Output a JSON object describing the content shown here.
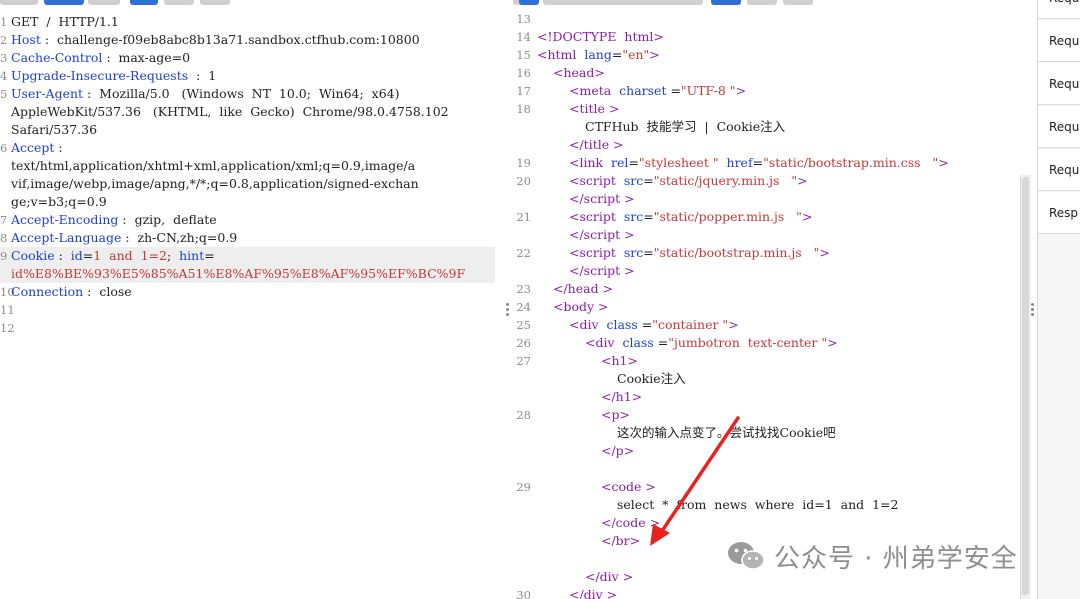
{
  "request": {
    "lines": [
      {
        "n": "1",
        "parts": [
          [
            "plain",
            "GET  /  HTTP/1.1"
          ]
        ]
      },
      {
        "n": "2",
        "parts": [
          [
            "hname",
            "Host"
          ],
          [
            "plain",
            " :  challenge-f09eb8abc8b13a71.sandbox.ctfhub.com:10800"
          ]
        ]
      },
      {
        "n": "3",
        "parts": [
          [
            "hname",
            "Cache-Control"
          ],
          [
            "plain",
            " :  max-age=0"
          ]
        ]
      },
      {
        "n": "4",
        "parts": [
          [
            "hname",
            "Upgrade-Insecure-Requests"
          ],
          [
            "plain",
            "  :  1"
          ]
        ]
      },
      {
        "n": "5",
        "parts": [
          [
            "hname",
            "User-Agent"
          ],
          [
            "plain",
            " :  Mozilla/5.0   (Windows  NT  10.0;  Win64;  x64)"
          ]
        ]
      },
      {
        "n": "",
        "parts": [
          [
            "plain",
            "AppleWebKit/537.36   (KHTML,  like  Gecko)  Chrome/98.0.4758.102"
          ]
        ]
      },
      {
        "n": "",
        "parts": [
          [
            "plain",
            "Safari/537.36"
          ]
        ]
      },
      {
        "n": "6",
        "parts": [
          [
            "hname",
            "Accept"
          ],
          [
            "plain",
            " :"
          ]
        ]
      },
      {
        "n": "",
        "parts": [
          [
            "plain",
            "text/html,application/xhtml+xml,application/xml;q=0.9,image/a"
          ]
        ]
      },
      {
        "n": "",
        "parts": [
          [
            "plain",
            "vif,image/webp,image/apng,*/*;q=0.8,application/signed-exchan"
          ]
        ]
      },
      {
        "n": "",
        "parts": [
          [
            "plain",
            "ge;v=b3;q=0.9"
          ]
        ]
      },
      {
        "n": "7",
        "parts": [
          [
            "hname",
            "Accept-Encoding"
          ],
          [
            "plain",
            " :  gzip,  deflate"
          ]
        ]
      },
      {
        "n": "8",
        "parts": [
          [
            "hname",
            "Accept-Language"
          ],
          [
            "plain",
            " :  zh-CN,zh;q=0.9"
          ]
        ]
      },
      {
        "n": "9",
        "hl": true,
        "parts": [
          [
            "hname",
            "Cookie"
          ],
          [
            "plain",
            " :  "
          ],
          [
            "hname",
            "id"
          ],
          [
            "plain",
            "="
          ],
          [
            "cred",
            "1  and  1=2"
          ],
          [
            "plain",
            ";  "
          ],
          [
            "hname",
            "hint"
          ],
          [
            "plain",
            "="
          ]
        ]
      },
      {
        "n": "",
        "hl": true,
        "parts": [
          [
            "cred",
            "id%E8%BE%93%E5%85%A51%E8%AF%95%E8%AF%95%EF%BC%9F"
          ]
        ]
      },
      {
        "n": "10",
        "parts": [
          [
            "hname",
            "Connection"
          ],
          [
            "plain",
            " :  close"
          ]
        ]
      },
      {
        "n": "11",
        "parts": []
      },
      {
        "n": "12",
        "parts": []
      }
    ]
  },
  "response": {
    "lines": [
      {
        "n": "13",
        "indent": 0,
        "parts": []
      },
      {
        "n": "14",
        "indent": 0,
        "parts": [
          [
            "tag",
            "<!DOCTYPE  html>"
          ]
        ]
      },
      {
        "n": "15",
        "indent": 0,
        "parts": [
          [
            "tag",
            "<html"
          ],
          [
            "attr",
            "  lang"
          ],
          [
            "plain",
            "="
          ],
          [
            "aval",
            "\"en\""
          ],
          [
            "tag",
            ">"
          ]
        ]
      },
      {
        "n": "16",
        "indent": 1,
        "parts": [
          [
            "tag",
            "<head"
          ],
          [
            "tag",
            ">"
          ]
        ]
      },
      {
        "n": "17",
        "indent": 2,
        "parts": [
          [
            "tag",
            "<meta"
          ],
          [
            "attr",
            "  charset"
          ],
          [
            "plain",
            " ="
          ],
          [
            "aval",
            "\"UTF-8 \""
          ],
          [
            "tag",
            ">"
          ]
        ]
      },
      {
        "n": "18",
        "indent": 2,
        "parts": [
          [
            "tag",
            "<title"
          ],
          [
            "tag",
            " >"
          ]
        ]
      },
      {
        "n": "",
        "indent": 3,
        "parts": [
          [
            "plain",
            "CTFHub  技能学习  |  Cookie注入"
          ]
        ]
      },
      {
        "n": "",
        "indent": 2,
        "parts": [
          [
            "tag",
            "</title"
          ],
          [
            "tag",
            " >"
          ]
        ]
      },
      {
        "n": "19",
        "indent": 2,
        "parts": [
          [
            "tag",
            "<link"
          ],
          [
            "attr",
            "  rel"
          ],
          [
            "plain",
            "="
          ],
          [
            "aval",
            "\"stylesheet \""
          ],
          [
            "attr",
            "  href"
          ],
          [
            "plain",
            "="
          ],
          [
            "aval",
            "\"static/bootstrap.min.css   \""
          ],
          [
            "tag",
            ">"
          ]
        ]
      },
      {
        "n": "20",
        "indent": 2,
        "parts": [
          [
            "tag",
            "<script"
          ],
          [
            "attr",
            "  src"
          ],
          [
            "plain",
            "="
          ],
          [
            "aval",
            "\"static/jquery.min.js   \""
          ],
          [
            "tag",
            ">"
          ]
        ]
      },
      {
        "n": "",
        "indent": 2,
        "parts": [
          [
            "tag",
            "</script"
          ],
          [
            "tag",
            " >"
          ]
        ]
      },
      {
        "n": "21",
        "indent": 2,
        "parts": [
          [
            "tag",
            "<script"
          ],
          [
            "attr",
            "  src"
          ],
          [
            "plain",
            "="
          ],
          [
            "aval",
            "\"static/popper.min.js   \""
          ],
          [
            "tag",
            ">"
          ]
        ]
      },
      {
        "n": "",
        "indent": 2,
        "parts": [
          [
            "tag",
            "</script"
          ],
          [
            "tag",
            " >"
          ]
        ]
      },
      {
        "n": "22",
        "indent": 2,
        "parts": [
          [
            "tag",
            "<script"
          ],
          [
            "attr",
            "  src"
          ],
          [
            "plain",
            "="
          ],
          [
            "aval",
            "\"static/bootstrap.min.js   \""
          ],
          [
            "tag",
            ">"
          ]
        ]
      },
      {
        "n": "",
        "indent": 2,
        "parts": [
          [
            "tag",
            "</script"
          ],
          [
            "tag",
            " >"
          ]
        ]
      },
      {
        "n": "23",
        "indent": 1,
        "parts": [
          [
            "tag",
            "</head"
          ],
          [
            "tag",
            " >"
          ]
        ]
      },
      {
        "n": "24",
        "indent": 1,
        "parts": [
          [
            "tag",
            "<body"
          ],
          [
            "tag",
            " >"
          ]
        ]
      },
      {
        "n": "25",
        "indent": 2,
        "parts": [
          [
            "tag",
            "<div"
          ],
          [
            "attr",
            "  class"
          ],
          [
            "plain",
            " ="
          ],
          [
            "aval",
            "\"container \""
          ],
          [
            "tag",
            ">"
          ]
        ]
      },
      {
        "n": "26",
        "indent": 3,
        "parts": [
          [
            "tag",
            "<div"
          ],
          [
            "attr",
            "  class"
          ],
          [
            "plain",
            " ="
          ],
          [
            "aval",
            "\"jumbotron  text-center \""
          ],
          [
            "tag",
            ">"
          ]
        ]
      },
      {
        "n": "27",
        "indent": 4,
        "parts": [
          [
            "tag",
            "<h1"
          ],
          [
            "tag",
            ">"
          ]
        ]
      },
      {
        "n": "",
        "indent": 5,
        "parts": [
          [
            "plain",
            "Cookie注入"
          ]
        ]
      },
      {
        "n": "",
        "indent": 4,
        "parts": [
          [
            "tag",
            "</h1"
          ],
          [
            "tag",
            ">"
          ]
        ]
      },
      {
        "n": "28",
        "indent": 4,
        "parts": [
          [
            "tag",
            "<p"
          ],
          [
            "tag",
            ">"
          ]
        ]
      },
      {
        "n": "",
        "indent": 5,
        "parts": [
          [
            "plain",
            "这次的输入点变了。尝试找找Cookie吧"
          ]
        ]
      },
      {
        "n": "",
        "indent": 4,
        "parts": [
          [
            "tag",
            "</p"
          ],
          [
            "tag",
            ">"
          ]
        ]
      },
      {
        "n": "",
        "indent": 0,
        "parts": []
      },
      {
        "n": "29",
        "indent": 4,
        "parts": [
          [
            "tag",
            "<code"
          ],
          [
            "tag",
            " >"
          ]
        ]
      },
      {
        "n": "",
        "indent": 5,
        "parts": [
          [
            "plain",
            "select  *  from  news  where  id=1  and  1=2"
          ]
        ]
      },
      {
        "n": "",
        "indent": 4,
        "parts": [
          [
            "tag",
            "</code"
          ],
          [
            "tag",
            " >"
          ]
        ]
      },
      {
        "n": "",
        "indent": 4,
        "parts": [
          [
            "tag",
            "</br"
          ],
          [
            "tag",
            ">"
          ]
        ]
      },
      {
        "n": "",
        "indent": 0,
        "parts": []
      },
      {
        "n": "",
        "indent": 3,
        "parts": [
          [
            "tag",
            "</div"
          ],
          [
            "tag",
            " >"
          ]
        ]
      },
      {
        "n": "30",
        "indent": 2,
        "parts": [
          [
            "tag",
            "</div"
          ],
          [
            "tag",
            " >"
          ]
        ]
      }
    ]
  },
  "sidebar": {
    "items": [
      "Requ",
      "Requ",
      "Requ",
      "Requ",
      "Requ",
      "Resp"
    ]
  },
  "watermark": {
    "text": "公众号 · 州弟学安全"
  },
  "colors": {
    "header_name": "#1f3fd4",
    "cookie_value": "#c33838",
    "tag": "#8b1ea8",
    "annotation_arrow": "#e8231f",
    "tab_accent": "#2f6fd6"
  }
}
